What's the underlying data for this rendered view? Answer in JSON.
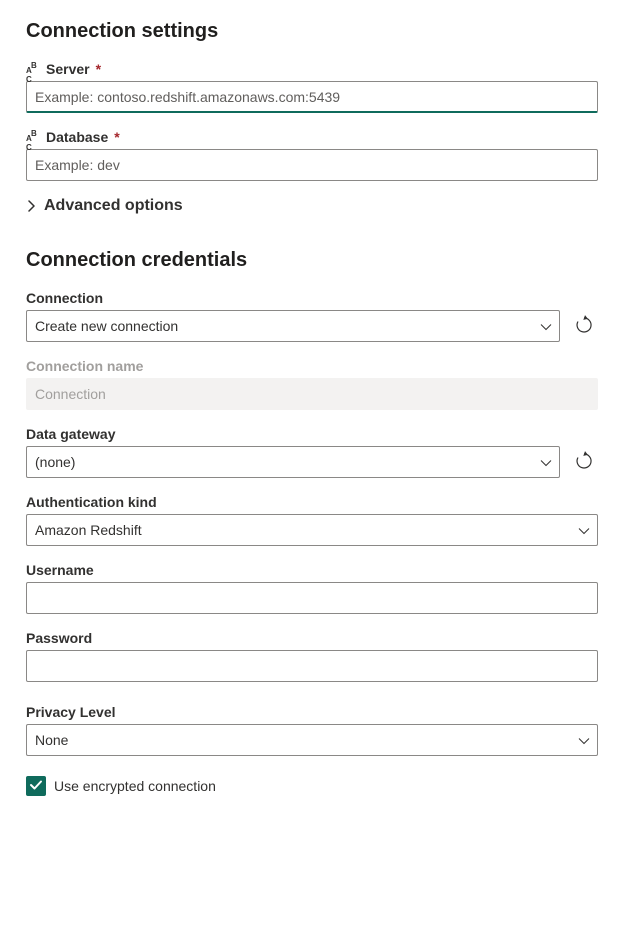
{
  "settings": {
    "heading": "Connection settings",
    "server_label": "Server",
    "server_placeholder": "Example: contoso.redshift.amazonaws.com:5439",
    "server_value": "",
    "database_label": "Database",
    "database_placeholder": "Example: dev",
    "database_value": "",
    "advanced_label": "Advanced options"
  },
  "credentials": {
    "heading": "Connection credentials",
    "connection_label": "Connection",
    "connection_value": "Create new connection",
    "connection_name_label": "Connection name",
    "connection_name_placeholder": "Connection",
    "gateway_label": "Data gateway",
    "gateway_value": "(none)",
    "auth_label": "Authentication kind",
    "auth_value": "Amazon Redshift",
    "username_label": "Username",
    "username_value": "",
    "password_label": "Password",
    "password_value": "",
    "privacy_label": "Privacy Level",
    "privacy_value": "None",
    "encrypted_label": "Use encrypted connection",
    "encrypted_checked": true
  }
}
